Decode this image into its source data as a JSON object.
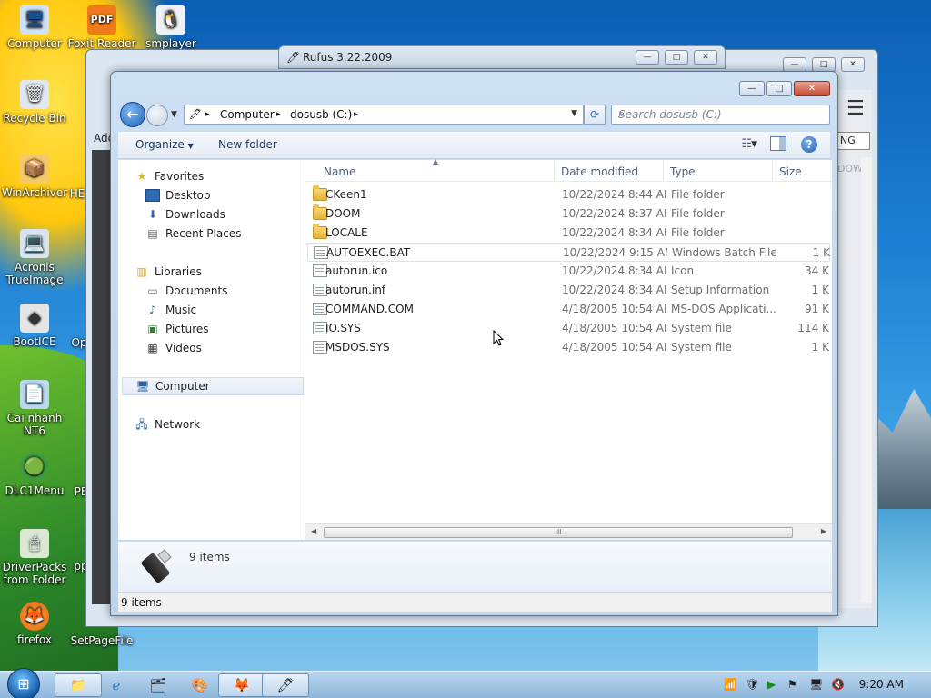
{
  "desktop": {
    "icons": [
      {
        "label": "Computer",
        "glyph": "🖥"
      },
      {
        "label": "Foxit Reader",
        "glyph": "PDF"
      },
      {
        "label": "smplayer",
        "glyph": "🐧"
      },
      {
        "label": "Recycle Bin",
        "glyph": "🗑"
      },
      {
        "label": "WinArchiver",
        "glyph": "📦"
      },
      {
        "label": "HE",
        "glyph": ""
      },
      {
        "label": "Acronis TrueImage",
        "glyph": "💻"
      },
      {
        "label": "BootICE",
        "glyph": "◆"
      },
      {
        "label": "Op",
        "glyph": ""
      },
      {
        "label": "Cai nhanh NT6",
        "glyph": "📄"
      },
      {
        "label": "DLC1Menu",
        "glyph": "🟢"
      },
      {
        "label": "PE",
        "glyph": ""
      },
      {
        "label": "DriverPacks from Folder",
        "glyph": "🖱"
      },
      {
        "label": "pp",
        "glyph": ""
      },
      {
        "label": "firefox",
        "glyph": "🦊"
      },
      {
        "label": "SetPageFile",
        "glyph": ""
      }
    ]
  },
  "rufus": {
    "title": "Rufus 3.22.2009"
  },
  "host": {
    "partial_label": "Add",
    "partial_right": "NG",
    "partial_right2": "DOW"
  },
  "explorer": {
    "controls": {
      "minimize": "—",
      "maximize": "□",
      "close": "✕"
    },
    "address": {
      "segments": [
        "Computer",
        "dosusb (C:)"
      ],
      "separator": "▸"
    },
    "search": {
      "placeholder": "Search dosusb (C:)"
    },
    "toolbar": {
      "organize": "Organize",
      "new_folder": "New folder"
    },
    "nav": {
      "favorites": "Favorites",
      "desktop": "Desktop",
      "downloads": "Downloads",
      "recent_places": "Recent Places",
      "libraries": "Libraries",
      "documents": "Documents",
      "music": "Music",
      "pictures": "Pictures",
      "videos": "Videos",
      "computer": "Computer",
      "network": "Network"
    },
    "columns": {
      "name": "Name",
      "date": "Date modified",
      "type": "Type",
      "size": "Size"
    },
    "files": [
      {
        "name": "CKeen1",
        "date": "10/22/2024 8:44 AM",
        "type": "File folder",
        "size": "",
        "kind": "folder"
      },
      {
        "name": "DOOM",
        "date": "10/22/2024 8:37 AM",
        "type": "File folder",
        "size": "",
        "kind": "folder"
      },
      {
        "name": "LOCALE",
        "date": "10/22/2024 8:34 AM",
        "type": "File folder",
        "size": "",
        "kind": "folder"
      },
      {
        "name": "AUTOEXEC.BAT",
        "date": "10/22/2024 9:15 AM",
        "type": "Windows Batch File",
        "size": "1 K",
        "kind": "file"
      },
      {
        "name": "autorun.ico",
        "date": "10/22/2024 8:34 AM",
        "type": "Icon",
        "size": "34 K",
        "kind": "icon"
      },
      {
        "name": "autorun.inf",
        "date": "10/22/2024 8:34 AM",
        "type": "Setup Information",
        "size": "1 K",
        "kind": "setup"
      },
      {
        "name": "COMMAND.COM",
        "date": "4/18/2005 10:54 AM",
        "type": "MS-DOS Applicati...",
        "size": "91 K",
        "kind": "file"
      },
      {
        "name": "IO.SYS",
        "date": "4/18/2005 10:54 AM",
        "type": "System file",
        "size": "114 K",
        "kind": "file"
      },
      {
        "name": "MSDOS.SYS",
        "date": "4/18/2005 10:54 AM",
        "type": "System file",
        "size": "1 K",
        "kind": "file"
      }
    ],
    "details_count": "9 items",
    "status_count": "9 items",
    "scroll_grip": "III"
  },
  "taskbar": {
    "clock": "9:20 AM"
  }
}
